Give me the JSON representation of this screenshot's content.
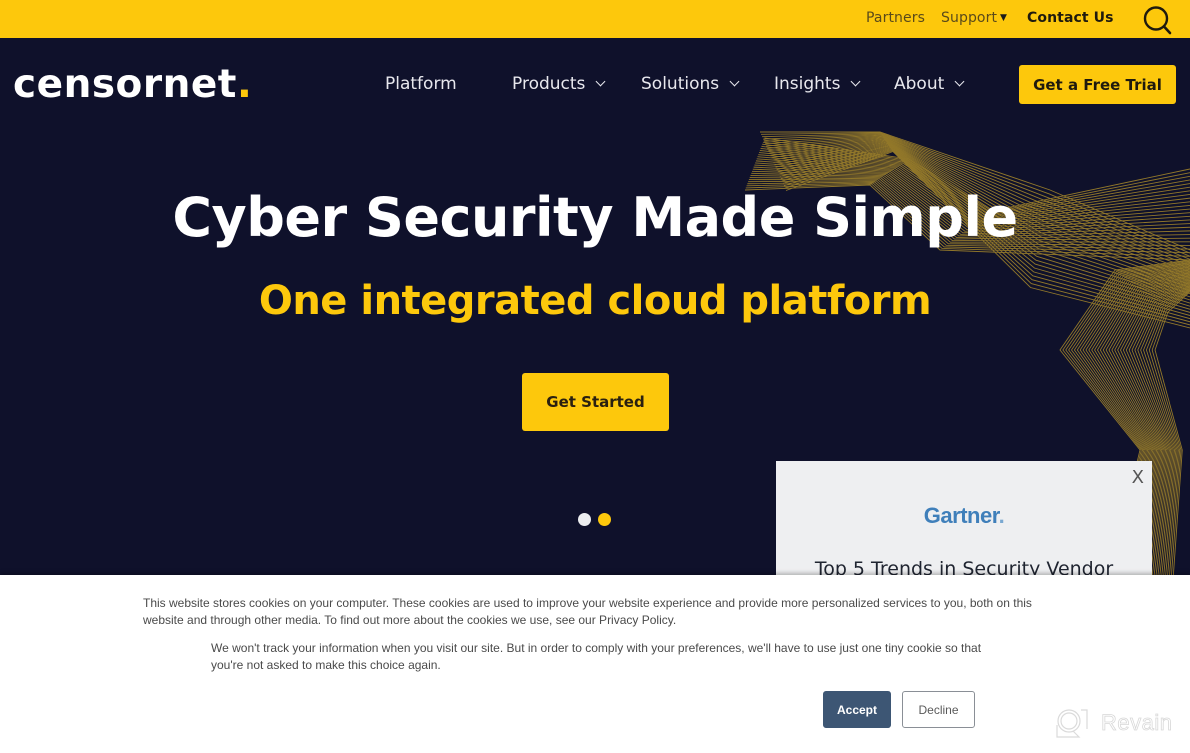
{
  "topbar": {
    "partners": "Partners",
    "support": "Support",
    "contact": "Contact Us",
    "search_icon": "search-icon"
  },
  "nav": {
    "logo_text": "censornet",
    "logo_dot": ".",
    "items": [
      {
        "label": "Platform",
        "has_dropdown": false
      },
      {
        "label": "Products",
        "has_dropdown": true
      },
      {
        "label": "Solutions",
        "has_dropdown": true
      },
      {
        "label": "Insights",
        "has_dropdown": true
      },
      {
        "label": "About",
        "has_dropdown": true
      }
    ],
    "cta": "Get a Free Trial"
  },
  "hero": {
    "title": "Cyber Security Made Simple",
    "subtitle": "One integrated cloud platform",
    "cta": "Get Started",
    "slides_total": 2,
    "active_slide": 2
  },
  "popup": {
    "close": "X",
    "brand": "Gartner",
    "brand_period": ".",
    "headline": "Top 5 Trends in Security Vendor"
  },
  "cookie_banner": {
    "text1": "This website stores cookies on your computer. These cookies are used to improve your website experience and provide more personalized services to you, both on this website and through other media. To find out more about the cookies we use, see our Privacy Policy.",
    "text2": "We won't track your information when you visit our site. But in order to comply with your preferences, we'll have to use just one tiny cookie so that you're not asked to make this choice again.",
    "accept": "Accept",
    "decline": "Decline"
  },
  "watermark": {
    "text": "Revain"
  },
  "colors": {
    "brand_yellow": "#fdc80c",
    "navy": "#0f112b",
    "accept_blue": "#3d5674",
    "gartner_blue": "#3f7fba"
  }
}
